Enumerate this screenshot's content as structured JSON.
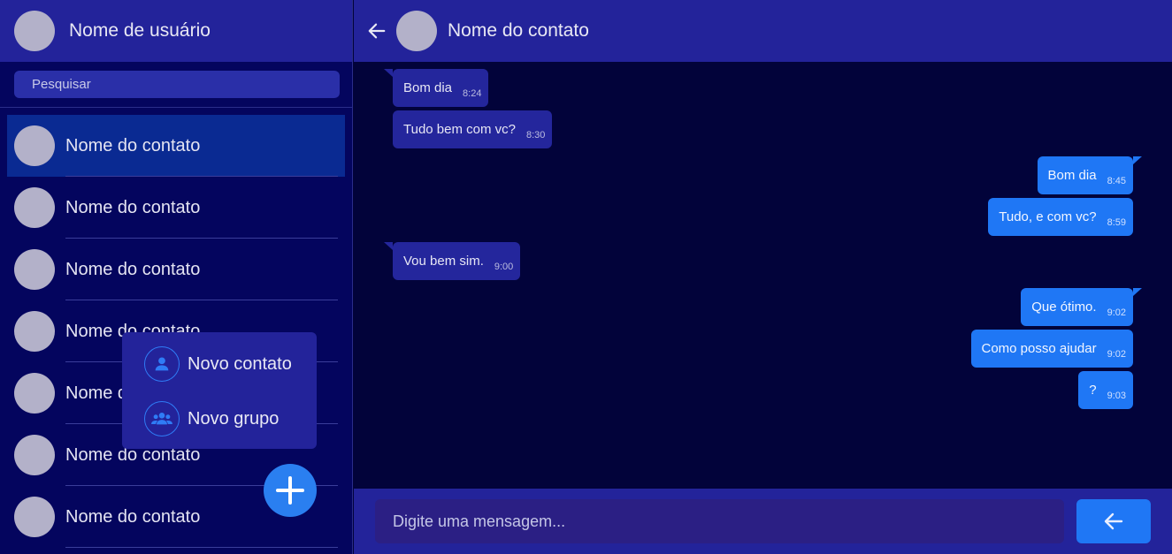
{
  "sidebar": {
    "user_name": "Nome de usuário",
    "search_placeholder": "Pesquisar",
    "contacts": [
      {
        "name": "Nome do contato"
      },
      {
        "name": "Nome do contato"
      },
      {
        "name": "Nome do contato"
      },
      {
        "name": "Nome do contato"
      },
      {
        "name": "Nome do contato"
      },
      {
        "name": "Nome do contato"
      },
      {
        "name": "Nome do contato"
      }
    ],
    "menu": {
      "new_contact": "Novo contato",
      "new_group": "Novo grupo"
    },
    "fab_icon": "plus-icon"
  },
  "chat": {
    "contact_name": "Nome do contato",
    "messages": [
      {
        "text": "Bom dia",
        "time": "8:24",
        "direction": "in"
      },
      {
        "text": "Tudo bem com vc?",
        "time": "8:30",
        "direction": "in"
      },
      {
        "text": "Bom dia",
        "time": "8:45",
        "direction": "out"
      },
      {
        "text": "Tudo, e com vc?",
        "time": "8:59",
        "direction": "out"
      },
      {
        "text": "Vou bem sim.",
        "time": "9:00",
        "direction": "in"
      },
      {
        "text": "Que ótimo.",
        "time": "9:02",
        "direction": "out"
      },
      {
        "text": "Como posso ajudar",
        "time": "9:02",
        "direction": "out"
      },
      {
        "text": "?",
        "time": "9:03",
        "direction": "out"
      }
    ],
    "input_placeholder": "Digite uma mensagem...",
    "send_icon": "arrow-left-icon"
  },
  "colors": {
    "sidebar_bg": "#04055e",
    "header_bg": "#23239a",
    "chat_bg": "#02033a",
    "incoming_bubble": "#24269c",
    "outgoing_bubble": "#1f77f5",
    "accent": "#2a7ff0"
  }
}
